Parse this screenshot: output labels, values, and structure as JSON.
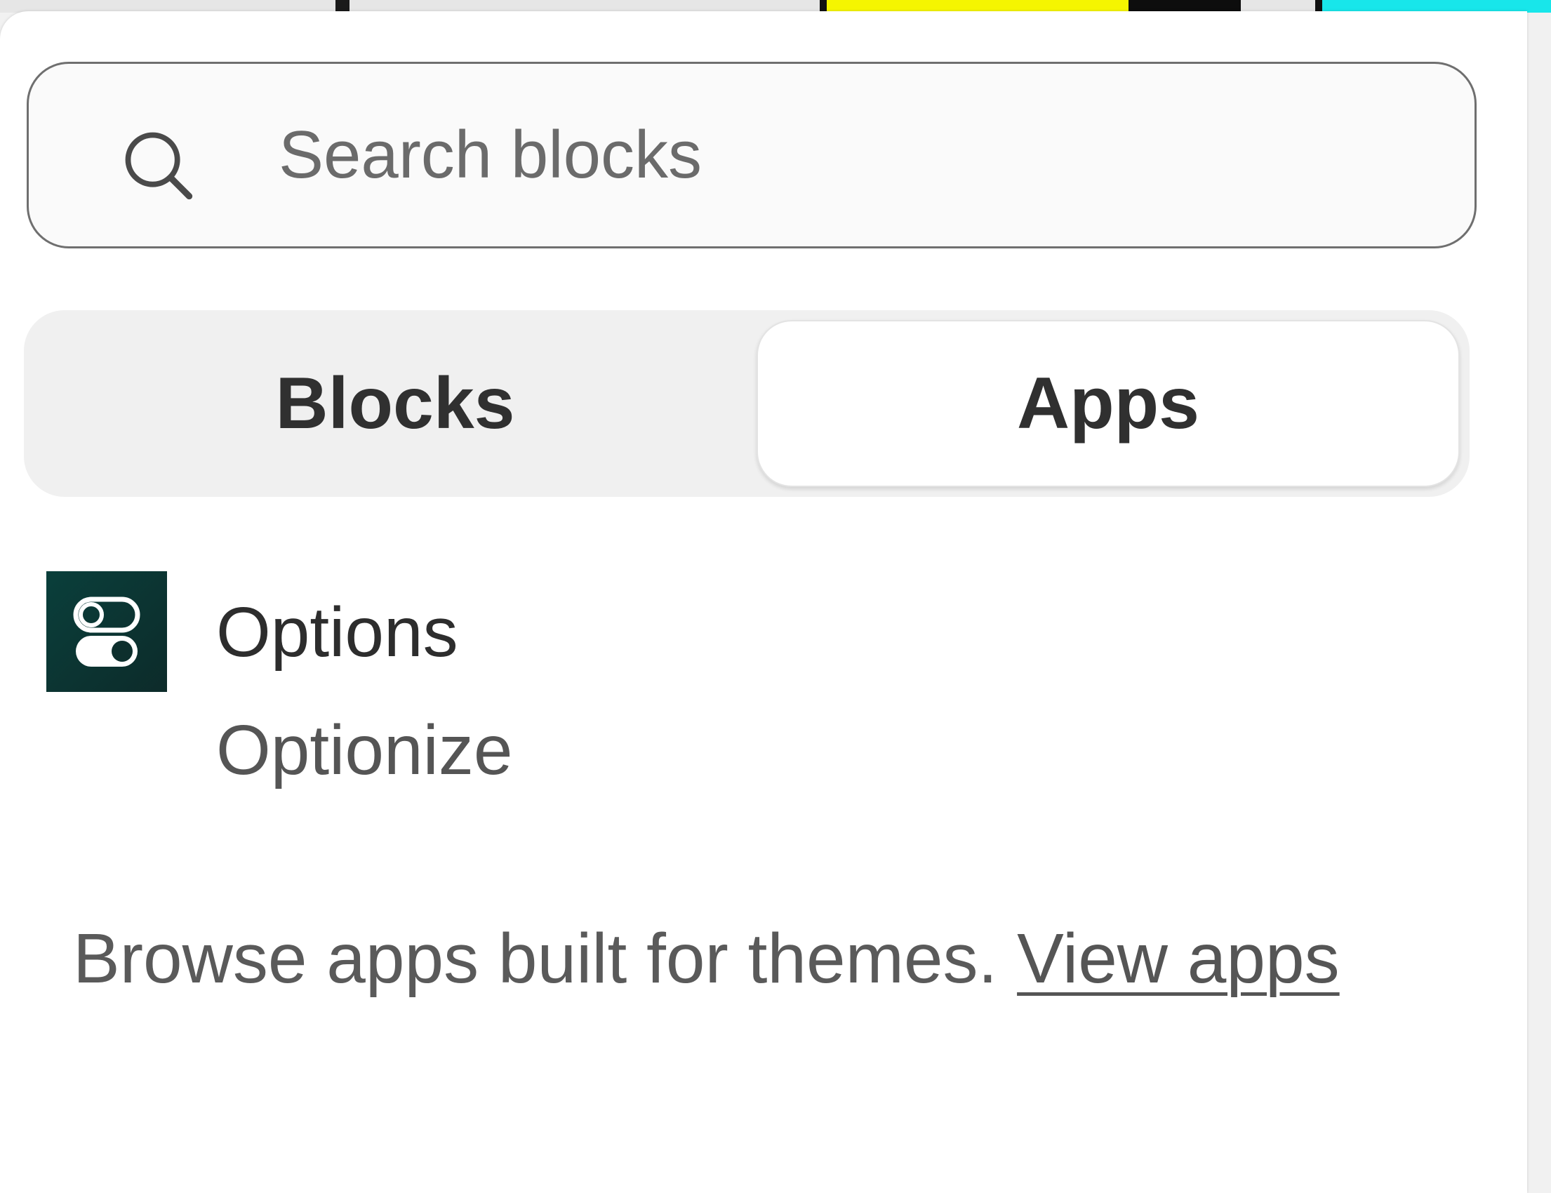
{
  "search": {
    "placeholder": "Search blocks",
    "icon": "search-icon"
  },
  "tabs": [
    {
      "label": "Blocks",
      "selected": false
    },
    {
      "label": "Apps",
      "selected": true
    }
  ],
  "apps": [
    {
      "name": "Options",
      "developer": "Optionize",
      "icon": "options-app-icon",
      "icon_color": "#0b3a37"
    }
  ],
  "footer": {
    "text": "Browse apps built for themes. ",
    "link_label": "View apps"
  },
  "colors": {
    "panel_bg": "#ffffff",
    "segmented_bg": "#f0f0f0",
    "text": "#303030"
  }
}
